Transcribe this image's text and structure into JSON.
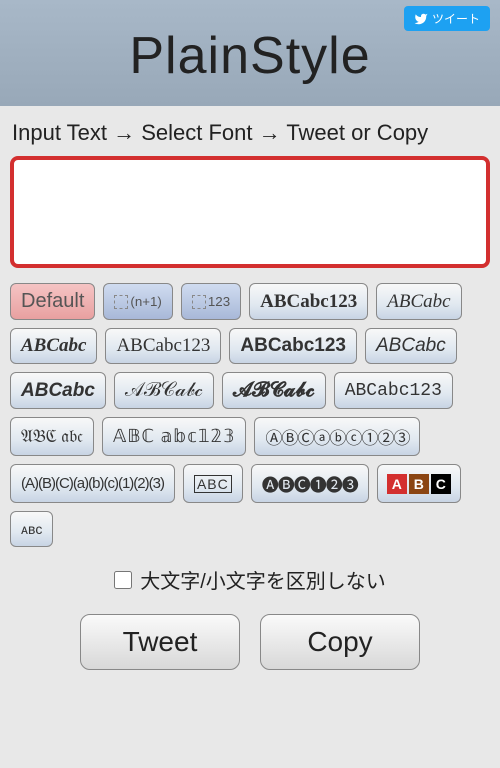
{
  "header": {
    "title": "PlainStyle",
    "tweet_share_label": "ツイート"
  },
  "instruction": "Input Text → Select Font → Tweet or Copy",
  "textarea": {
    "value": "",
    "placeholder": ""
  },
  "font_buttons": {
    "default": "Default",
    "superscript": "(n+1)",
    "subscript": "123",
    "bold_serif": "ABCabc123",
    "italic_serif": "ABCabc",
    "bolditalic_serif": "ABCabc",
    "serif": "ABCabc123",
    "bold_sans": "ABCabc123",
    "italic_sans": "ABCabc",
    "bolditalic_sans": "ABCabc",
    "script": "𝒜ℬ𝒞𝒶𝒷𝒸",
    "script_bold": "𝓐𝓑𝓒𝓪𝓫𝓬",
    "mono": "ABCabc123",
    "fraktur": "𝔄𝔅ℭ 𝔞𝔟𝔠",
    "doublestruck": "𝔸𝔹ℂ 𝕒𝕓𝕔𝟙𝟚𝟛",
    "circled": "ⒶⒷⒸⓐⓑⓒ①②③",
    "paren": "(A)(B)(C)(a)(b)(c)(1)(2)(3)",
    "boxed": "ABC",
    "neg_circled": "🅐🅑🅒❶❷❸",
    "colorblock_a": "A",
    "colorblock_b": "B",
    "colorblock_c": "C",
    "smallcaps": "ᴀʙᴄ"
  },
  "checkbox": {
    "label": "大文字/小文字を区別しない",
    "checked": false
  },
  "actions": {
    "tweet": "Tweet",
    "copy": "Copy"
  },
  "colors": {
    "accent_red": "#d32f2f",
    "header_bg": "#a0b0c0",
    "twitter_blue": "#1da1f2"
  }
}
